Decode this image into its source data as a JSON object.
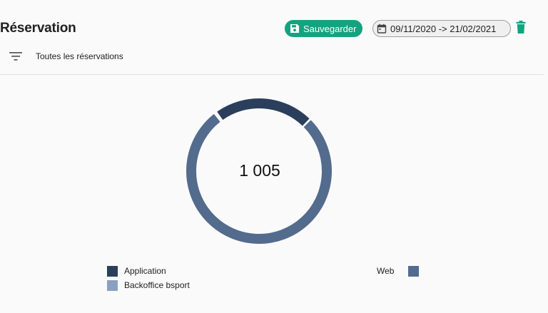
{
  "header": {
    "title": "Réservation",
    "save_label": "Sauvegarder",
    "date_range": "09/11/2020 -> 21/02/2021"
  },
  "filter": {
    "label": "Toutes les réservations"
  },
  "colors": {
    "accent_green": "#14a37f",
    "application": "#2b3f5c",
    "web": "#536b8d",
    "backoffice": "#8aa0c1"
  },
  "chart_data": {
    "type": "pie",
    "style": "donut",
    "total_label": "1 005",
    "categories": [
      "Application",
      "Web",
      "Backoffice bsport"
    ],
    "values": [
      225,
      776,
      4
    ],
    "colors": [
      "#2b3f5c",
      "#536b8d",
      "#8aa0c1"
    ],
    "legend_placement": "bottom"
  }
}
